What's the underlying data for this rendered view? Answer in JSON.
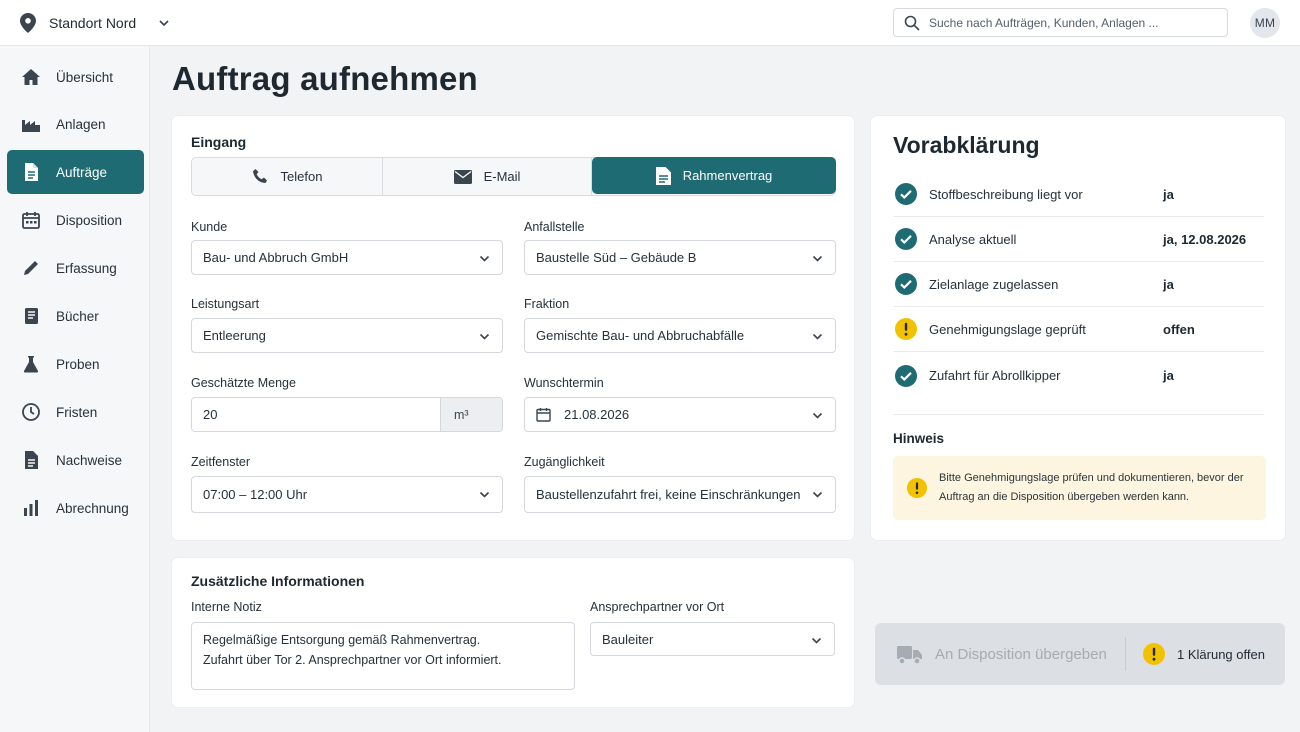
{
  "topbar": {
    "location": "Standort Nord",
    "search_placeholder": "Suche nach Aufträgen, Kunden, Anlagen ...",
    "avatar_initials": "MM"
  },
  "sidebar": {
    "items": [
      {
        "label": "Übersicht",
        "icon": "home-icon"
      },
      {
        "label": "Anlagen",
        "icon": "factory-icon"
      },
      {
        "label": "Aufträge",
        "icon": "document-icon",
        "active": true
      },
      {
        "label": "Disposition",
        "icon": "calendar-icon"
      },
      {
        "label": "Erfassung",
        "icon": "pencil-icon"
      },
      {
        "label": "Bücher",
        "icon": "book-icon"
      },
      {
        "label": "Proben",
        "icon": "flask-icon"
      },
      {
        "label": "Fristen",
        "icon": "clock-icon"
      },
      {
        "label": "Nachweise",
        "icon": "document-icon"
      },
      {
        "label": "Abrechnung",
        "icon": "bar-chart-icon"
      }
    ]
  },
  "page": {
    "title": "Auftrag aufnehmen"
  },
  "eingang": {
    "title": "Eingang",
    "channels": [
      {
        "label": "Telefon",
        "icon": "phone-icon"
      },
      {
        "label": "E-Mail",
        "icon": "mail-icon"
      },
      {
        "label": "Rahmenvertrag",
        "icon": "contract-icon",
        "selected": true
      }
    ]
  },
  "form": {
    "kunde": {
      "label": "Kunde",
      "value": "Bau- und Abbruch GmbH"
    },
    "anfallstelle": {
      "label": "Anfallstelle",
      "value": "Baustelle Süd – Gebäude B"
    },
    "leistungsart": {
      "label": "Leistungsart",
      "value": "Entleerung"
    },
    "fraktion": {
      "label": "Fraktion",
      "value": "Gemischte Bau- und Abbruchabfälle"
    },
    "menge": {
      "label": "Geschätzte Menge",
      "value": "20",
      "unit": "m³"
    },
    "wunschtermin": {
      "label": "Wunschtermin",
      "value": "21.08.2026"
    },
    "zeitfenster": {
      "label": "Zeitfenster",
      "value": "07:00 – 12:00 Uhr"
    },
    "zugaenglichkeit": {
      "label": "Zugänglichkeit",
      "value": "Baustellenzufahrt frei, keine Einschränkungen"
    }
  },
  "extra": {
    "title": "Zusätzliche Informationen",
    "notiz_label": "Interne Notiz",
    "notiz_line1": "Regelmäßige Entsorgung gemäß Rahmenvertrag.",
    "notiz_line2": "Zufahrt über Tor 2. Ansprechpartner vor Ort informiert.",
    "ansprechpartner_label": "Ansprechpartner vor Ort",
    "ansprechpartner_value": "Bauleiter"
  },
  "vorabklaerung": {
    "title": "Vorabklärung",
    "checks": [
      {
        "label": "Stoffbeschreibung liegt vor",
        "value": "ja",
        "status": "ok"
      },
      {
        "label": "Analyse aktuell",
        "value": "ja, 12.08.2026",
        "status": "ok"
      },
      {
        "label": "Zielanlage zugelassen",
        "value": "ja",
        "status": "ok"
      },
      {
        "label": "Genehmigungslage geprüft",
        "value": "offen",
        "status": "warning"
      },
      {
        "label": "Zufahrt für Abrollkipper",
        "value": "ja",
        "status": "ok"
      }
    ],
    "hint_title": "Hinweis",
    "hint_text": "Bitte Genehmigungslage prüfen und dokumentieren, bevor der Auftrag an die Disposition übergeben werden kann."
  },
  "handover": {
    "button_label": "An Disposition übergeben",
    "status_text": "1 Klärung offen"
  },
  "colors": {
    "accent": "#1f6b73",
    "ok": "#1f6b73",
    "warning": "#f2c200",
    "hint_bg": "#fdf5df"
  }
}
